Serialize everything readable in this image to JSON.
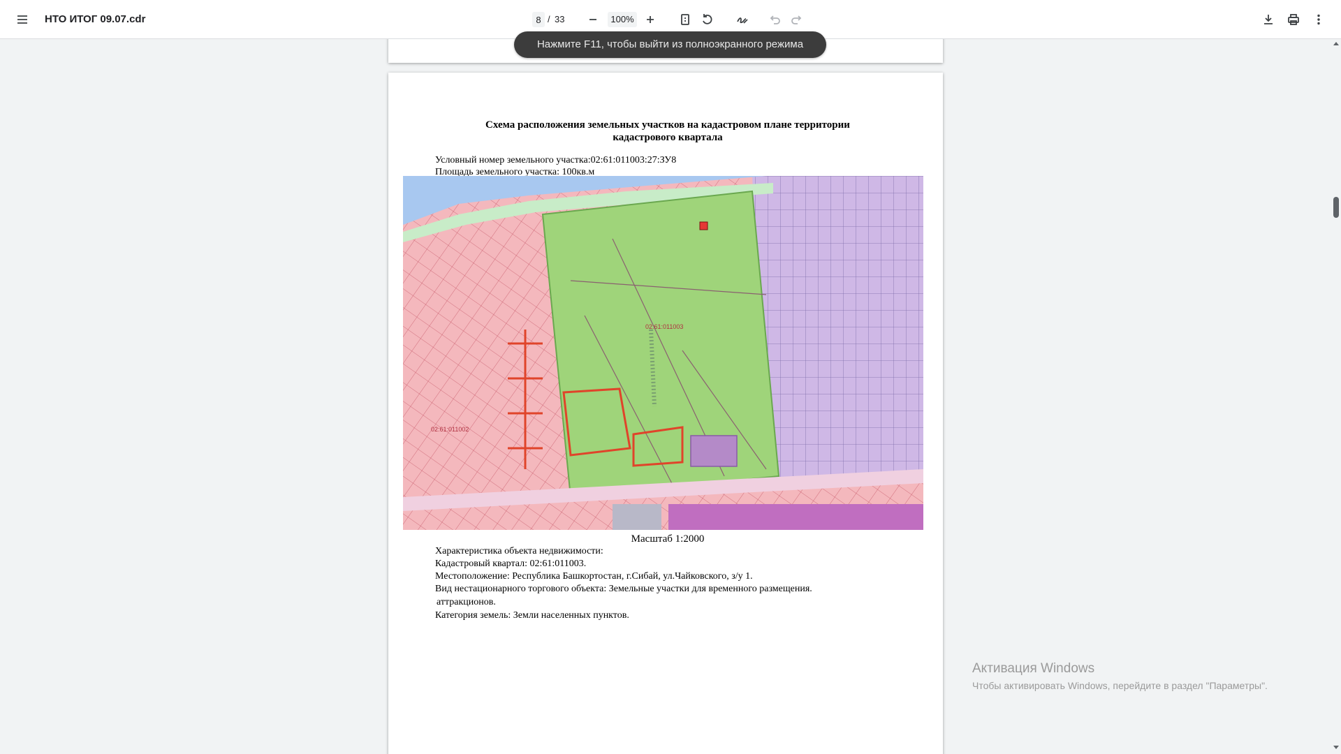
{
  "toolbar": {
    "title": "НТО ИТОГ 09.07.cdr",
    "page_current": "8",
    "page_separator": "/",
    "page_total": "33",
    "zoom": "100%"
  },
  "icons": {
    "menu": "menu-icon",
    "zoom_out": "minus-icon",
    "zoom_in": "plus-icon",
    "fit": "fit-page-icon",
    "rotate": "rotate-icon",
    "annotate": "draw-icon",
    "undo": "undo-icon",
    "redo": "redo-icon",
    "download": "download-icon",
    "print": "print-icon",
    "more": "more-vert-icon"
  },
  "toast": {
    "text": "Нажмите F11, чтобы выйти из полноэкранного режима"
  },
  "document": {
    "heading_line1": "Схема расположения земельных участков на кадастровом плане территории",
    "heading_line2": "кадастрового квартала",
    "plot_number": "Условный номер земельного участка:02:61:011003:27:ЗУ8",
    "plot_area": "Площадь земельного участка: 100кв.м",
    "map_label_main": "02:61:011003",
    "map_label_left": "02:61:011002",
    "scale": "Масштаб 1:2000",
    "char_title": "Характеристика объекта недвижимости:",
    "cadastral_quarter": "Кадастровый квартал: 02:61:011003.",
    "location": "Местоположение: Республика Башкортостан, г.Сибай, ул.Чайковского, з/у 1.",
    "object_type": "Вид нестационарного торгового объекта: Земельные участки для временного размещения.",
    "object_type_cont": "аттракционов.",
    "land_category": "Категория земель: Земли населенных пунктов."
  },
  "activation": {
    "title": "Активация Windows",
    "subtitle": "Чтобы активировать Windows, перейдите в раздел \"Параметры\"."
  },
  "colors": {
    "toolbar_bg": "#ffffff",
    "viewer_bg": "#f1f3f4",
    "map_green": "#9fd47a",
    "map_pink": "#f4b8bd",
    "map_violet": "#cfb8e6",
    "target_marker": "#e53935"
  }
}
